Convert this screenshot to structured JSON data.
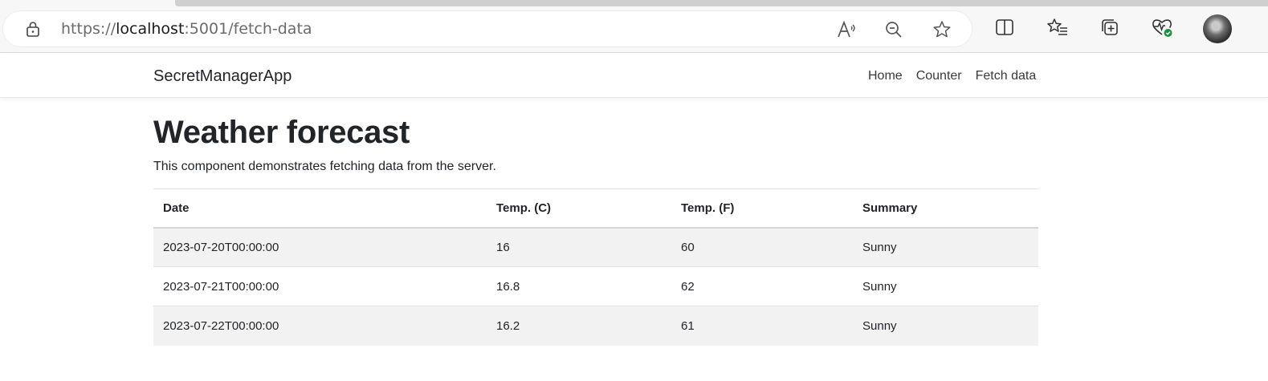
{
  "browser": {
    "url_scheme": "https://",
    "url_host": "localhost",
    "url_rest": ":5001/fetch-data",
    "icons": [
      "lock-icon",
      "read-aloud-icon",
      "zoom-out-icon",
      "favorite-star-icon",
      "split-screen-icon",
      "favorites-list-icon",
      "collections-icon",
      "browser-health-icon",
      "profile-avatar"
    ]
  },
  "navbar": {
    "brand": "SecretManagerApp",
    "links": [
      "Home",
      "Counter",
      "Fetch data"
    ]
  },
  "page": {
    "title": "Weather forecast",
    "description": "This component demonstrates fetching data from the server."
  },
  "table": {
    "headers": [
      "Date",
      "Temp. (C)",
      "Temp. (F)",
      "Summary"
    ],
    "rows": [
      [
        "2023-07-20T00:00:00",
        "16",
        "60",
        "Sunny"
      ],
      [
        "2023-07-21T00:00:00",
        "16.8",
        "62",
        "Sunny"
      ],
      [
        "2023-07-22T00:00:00",
        "16.2",
        "61",
        "Sunny"
      ]
    ]
  },
  "colors": {
    "text": "#212529",
    "stripe": "#f2f2f2",
    "health_badge": "#1a8f3c"
  }
}
